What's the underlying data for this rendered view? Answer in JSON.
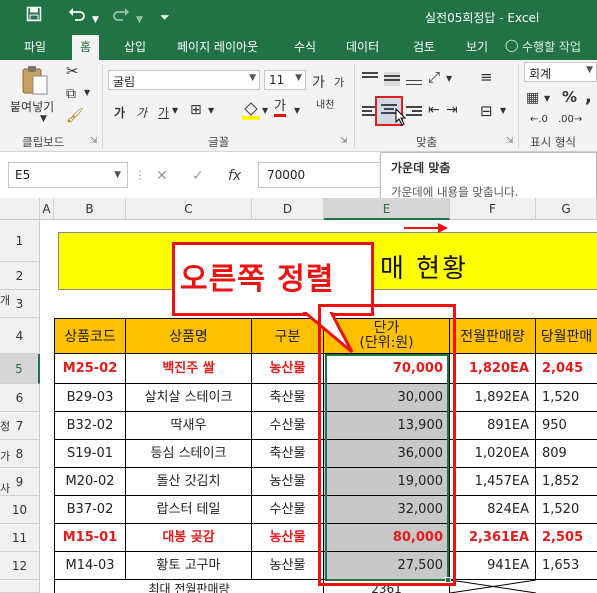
{
  "titlebar": {
    "title": "실전05회정답 - Excel",
    "save_icon": "save-icon",
    "undo_icon": "undo-icon",
    "redo_icon": "redo-icon",
    "qa_dropdown_icon": "dropdown-icon"
  },
  "tabs": [
    {
      "label": "파일"
    },
    {
      "label": "홈"
    },
    {
      "label": "삽입"
    },
    {
      "label": "페이지 레이아웃"
    },
    {
      "label": "수식"
    },
    {
      "label": "데이터"
    },
    {
      "label": "검토"
    },
    {
      "label": "보기"
    }
  ],
  "tellme": "수행할 작업",
  "ribbon": {
    "clipboard": {
      "paste_label": "붙여넣기",
      "group_label": "클립보드"
    },
    "font": {
      "font_name": "굴림",
      "font_size": "11",
      "bold": "가",
      "italic": "가",
      "underline": "가",
      "grow": "가",
      "shrink": "가",
      "phonetic": "내천",
      "font_color_glyph": "가",
      "group_label": "글꼴"
    },
    "alignment": {
      "group_label": "맞춤"
    },
    "number": {
      "format": "회계",
      "percent": "%",
      "comma": ",",
      "group_label": "표시 형식"
    }
  },
  "tooltip": {
    "title": "가운데 맞춤",
    "desc": "가운데에 내용을 맞춥니다."
  },
  "formula_bar": {
    "name_box": "E5",
    "fx": "fx",
    "value": "70000"
  },
  "columns": [
    "A",
    "B",
    "C",
    "D",
    "E",
    "F",
    "G"
  ],
  "rows": [
    "1",
    "2",
    "3",
    "4",
    "5",
    "6",
    "7",
    "8",
    "9",
    "10",
    "11",
    "12"
  ],
  "left_strip": [
    "개",
    "정",
    "가",
    "사"
  ],
  "banner_text": "매 현황",
  "callout_text": "오른쪽 정렬",
  "table": {
    "headers": [
      "상품코드",
      "상품명",
      "구분",
      "단가",
      "(단위:원)",
      "전월판매량",
      "당월판매"
    ],
    "rows": [
      {
        "code": "M25-02",
        "name": "백진주 쌀",
        "cat": "농산물",
        "price": "70,000",
        "prev": "1,820EA",
        "curr": "2,045"
      },
      {
        "code": "B29-03",
        "name": "살치살 스테이크",
        "cat": "축산물",
        "price": "30,000",
        "prev": "1,892EA",
        "curr": "1,520"
      },
      {
        "code": "B32-02",
        "name": "딱새우",
        "cat": "수산물",
        "price": "13,900",
        "prev": "891EA",
        "curr": "950"
      },
      {
        "code": "S19-01",
        "name": "등심 스테이크",
        "cat": "축산물",
        "price": "36,000",
        "prev": "1,020EA",
        "curr": "809"
      },
      {
        "code": "M20-02",
        "name": "돌산 갓김치",
        "cat": "농산물",
        "price": "19,000",
        "prev": "1,457EA",
        "curr": "1,852"
      },
      {
        "code": "B37-02",
        "name": "랍스터 테일",
        "cat": "수산물",
        "price": "32,000",
        "prev": "824EA",
        "curr": "1,520"
      },
      {
        "code": "M15-01",
        "name": "대봉 곶감",
        "cat": "농산물",
        "price": "80,000",
        "prev": "2,361EA",
        "curr": "2,505"
      },
      {
        "code": "M14-03",
        "name": "황토 고구마",
        "cat": "농산물",
        "price": "27,500",
        "prev": "941EA",
        "curr": "1,653"
      }
    ],
    "partial_row": {
      "label": "최대 전월판매량",
      "value": "2361"
    }
  }
}
